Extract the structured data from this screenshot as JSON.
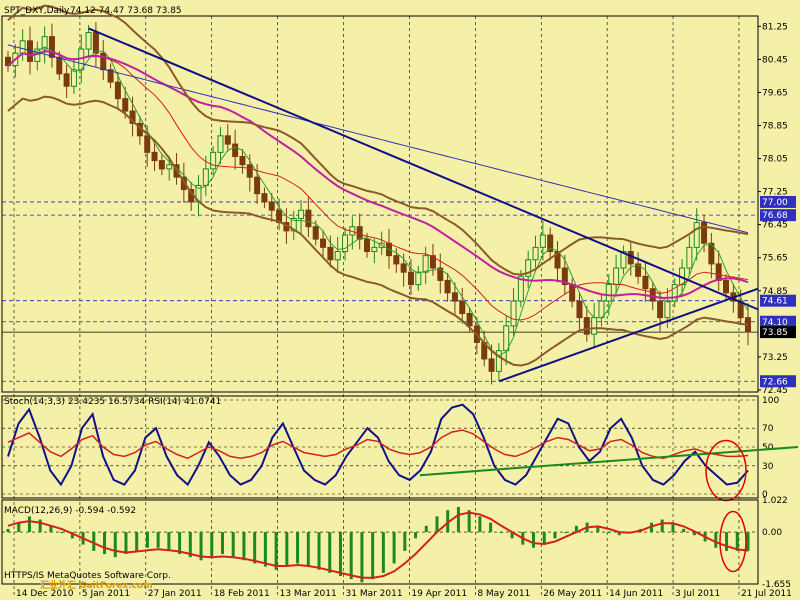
{
  "chart_data": [
    {
      "type": "candlestick",
      "title": "SPT_DXY,Daily",
      "ohlc_label": "74.12 74.47 73.68 73.85",
      "colors": {
        "background": "#f5f0a8",
        "bull": "#1a8a1a",
        "bear": "#7a3b10",
        "band": "#8b5a2b",
        "ma_long": "#2f2fb0",
        "ma_mid": "#c020a0",
        "ma_short": "#d42020",
        "trend": "#10108a"
      },
      "ylim": [
        72.4,
        81.5
      ],
      "y_ticks": [
        "81.25",
        "80.45",
        "79.65",
        "78.85",
        "78.05",
        "77.25",
        "76.45",
        "75.65",
        "74.85",
        "73.25",
        "72.45"
      ],
      "price_labels": [
        {
          "value": 77.0,
          "text": "77.00",
          "bg": "#3030c0"
        },
        {
          "value": 76.68,
          "text": "76.68",
          "bg": "#3030c0"
        },
        {
          "value": 74.61,
          "text": "74.61",
          "bg": "#3030c0"
        },
        {
          "value": 74.1,
          "text": "74.10",
          "bg": "#3030c0"
        },
        {
          "value": 73.85,
          "text": "73.85",
          "bg": "#000000"
        },
        {
          "value": 72.66,
          "text": "72.66",
          "bg": "#3030c0"
        }
      ],
      "series_close": [
        80.3,
        80.6,
        80.9,
        80.4,
        80.7,
        81.0,
        80.5,
        80.1,
        79.8,
        80.2,
        80.7,
        81.1,
        80.6,
        80.2,
        79.9,
        79.5,
        79.2,
        78.9,
        78.6,
        78.2,
        78.0,
        77.8,
        77.9,
        77.6,
        77.3,
        77.0,
        77.4,
        77.8,
        78.2,
        78.6,
        78.4,
        78.1,
        77.9,
        77.6,
        77.2,
        77.0,
        76.8,
        76.5,
        76.3,
        76.6,
        76.8,
        76.4,
        76.1,
        75.9,
        75.6,
        75.8,
        76.2,
        76.4,
        76.1,
        75.8,
        75.9,
        76.0,
        75.7,
        75.5,
        75.3,
        75.0,
        75.3,
        75.7,
        75.4,
        75.1,
        74.8,
        74.6,
        74.3,
        74.0,
        73.6,
        73.2,
        72.9,
        73.4,
        74.0,
        74.6,
        75.2,
        75.6,
        75.9,
        76.2,
        75.8,
        75.4,
        75.0,
        74.6,
        74.2,
        73.8,
        74.2,
        74.6,
        75.0,
        75.4,
        75.8,
        75.5,
        75.2,
        74.9,
        74.6,
        74.2,
        74.6,
        75.0,
        75.4,
        75.9,
        76.5,
        76.0,
        75.5,
        75.1,
        74.8,
        74.6,
        74.2,
        73.85
      ],
      "x_ticks": [
        "14 Dec 2010",
        "5 Jan 2011",
        "27 Jan 2011",
        "18 Feb 2011",
        "13 Mar 2011",
        "31 Mar 2011",
        "19 Apr 2011",
        "8 May 2011",
        "26 May 2011",
        "14 Jun 2011",
        "3 Jul 2011",
        "21 Jul 2011"
      ]
    },
    {
      "type": "line",
      "title": "Stoch(14,3,3) 23.4235 16.5734 RSI(14) 41.0741",
      "ylim": [
        0,
        100
      ],
      "y_ticks": [
        "100",
        "70",
        "50",
        "30",
        "0"
      ],
      "series": [
        {
          "color": "#10108a",
          "values": [
            40,
            75,
            90,
            60,
            25,
            10,
            30,
            70,
            85,
            40,
            15,
            10,
            25,
            60,
            70,
            40,
            20,
            10,
            30,
            55,
            40,
            20,
            10,
            15,
            30,
            60,
            75,
            50,
            25,
            15,
            10,
            20,
            40,
            55,
            70,
            60,
            35,
            20,
            15,
            25,
            45,
            80,
            92,
            95,
            85,
            60,
            30,
            15,
            10,
            20,
            40,
            60,
            80,
            75,
            50,
            35,
            45,
            70,
            80,
            60,
            30,
            15,
            10,
            20,
            35,
            45,
            30,
            20,
            10,
            12,
            25
          ]
        },
        {
          "color": "#d42020",
          "values": [
            55,
            60,
            65,
            55,
            45,
            40,
            48,
            58,
            62,
            50,
            42,
            40,
            44,
            52,
            56,
            48,
            42,
            38,
            44,
            50,
            46,
            40,
            38,
            40,
            44,
            52,
            56,
            50,
            44,
            42,
            40,
            42,
            48,
            52,
            58,
            56,
            48,
            44,
            42,
            44,
            50,
            60,
            66,
            68,
            64,
            56,
            48,
            42,
            40,
            44,
            50,
            56,
            60,
            58,
            52,
            46,
            48,
            56,
            58,
            52,
            44,
            40,
            38,
            42,
            46,
            48,
            44,
            42,
            40,
            40,
            41
          ]
        }
      ]
    },
    {
      "type": "bar",
      "title": "MACD(12,26,9) -0.594 -0.592",
      "ylim": [
        -1.655,
        1.022
      ],
      "y_ticks": [
        "1.022",
        "0.00",
        "-1.655"
      ],
      "values": [
        0.1,
        0.3,
        0.5,
        0.4,
        0.2,
        0.0,
        -0.2,
        -0.4,
        -0.6,
        -0.7,
        -0.8,
        -0.7,
        -0.6,
        -0.5,
        -0.5,
        -0.6,
        -0.7,
        -0.8,
        -0.9,
        -0.8,
        -0.7,
        -0.8,
        -0.9,
        -1.0,
        -1.1,
        -1.2,
        -1.1,
        -1.0,
        -1.1,
        -1.2,
        -1.3,
        -1.4,
        -1.5,
        -1.6,
        -1.5,
        -1.3,
        -1.0,
        -0.6,
        -0.2,
        0.2,
        0.5,
        0.7,
        0.8,
        0.7,
        0.5,
        0.3,
        0.0,
        -0.2,
        -0.4,
        -0.5,
        -0.4,
        -0.2,
        0.0,
        0.2,
        0.3,
        0.2,
        0.0,
        -0.1,
        0.0,
        0.1,
        0.3,
        0.4,
        0.3,
        0.1,
        -0.1,
        -0.3,
        -0.5,
        -0.6,
        -0.6,
        -0.6
      ],
      "signal": [
        0.2,
        0.3,
        0.35,
        0.3,
        0.2,
        0.1,
        -0.05,
        -0.2,
        -0.35,
        -0.5,
        -0.6,
        -0.65,
        -0.62,
        -0.58,
        -0.55,
        -0.58,
        -0.62,
        -0.7,
        -0.78,
        -0.8,
        -0.78,
        -0.8,
        -0.85,
        -0.92,
        -1.0,
        -1.08,
        -1.08,
        -1.05,
        -1.08,
        -1.14,
        -1.22,
        -1.3,
        -1.38,
        -1.45,
        -1.46,
        -1.4,
        -1.25,
        -1.0,
        -0.7,
        -0.35,
        0.0,
        0.3,
        0.55,
        0.62,
        0.56,
        0.42,
        0.2,
        0.0,
        -0.2,
        -0.35,
        -0.38,
        -0.3,
        -0.15,
        0.0,
        0.15,
        0.18,
        0.1,
        0.0,
        -0.02,
        0.05,
        0.18,
        0.28,
        0.28,
        0.18,
        0.02,
        -0.15,
        -0.32,
        -0.45,
        -0.55,
        -0.59
      ]
    }
  ],
  "footer": {
    "watermark": "汇业外汇 GaitForex.com",
    "copyright": "HTTPS/IS MetaQuotes Software Corp."
  }
}
